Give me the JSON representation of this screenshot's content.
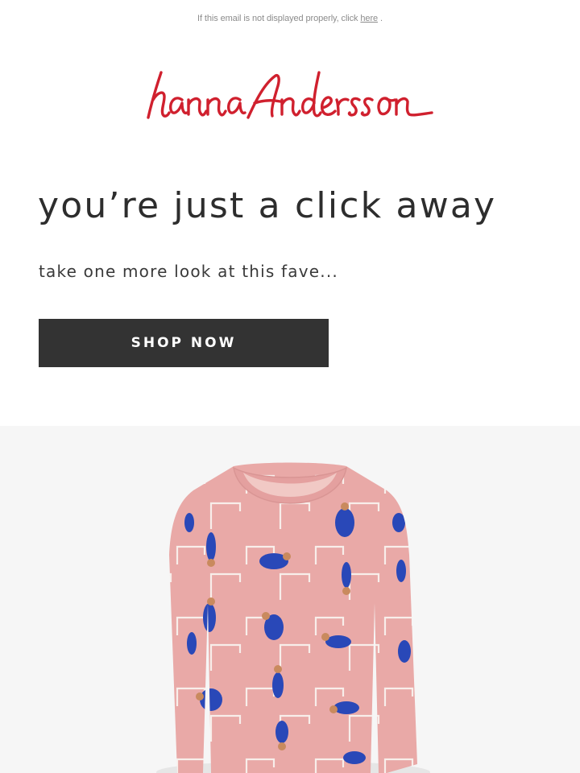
{
  "email": {
    "preheader_text": "If this email is not displayed properly, click ",
    "preheader_link": "here",
    "preheader_suffix": " .",
    "brand_name": "hanna Andersson",
    "headline": "you’re just a click away",
    "subhead": "take one more look at this fave...",
    "cta_label": "SHOP NOW"
  },
  "colors": {
    "brand_red": "#d0202e",
    "button_bg": "#333333",
    "product_panel_bg": "#f6f6f6",
    "shirt_pink": "#e9a9a7",
    "print_blue": "#2948b8"
  },
  "product": {
    "image_description": "pink long-sleeve pajama top with blue gymnast cat print",
    "icon": "product-image"
  }
}
